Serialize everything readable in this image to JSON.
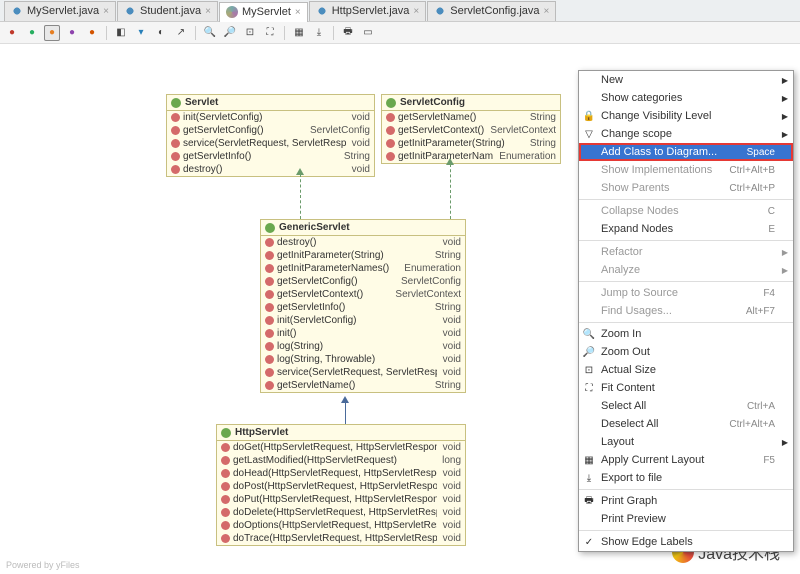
{
  "tabs": [
    {
      "label": "MyServlet.java",
      "icon": "java"
    },
    {
      "label": "Student.java",
      "icon": "java"
    },
    {
      "label": "MyServlet",
      "icon": "diagram",
      "active": true
    },
    {
      "label": "HttpServlet.java",
      "icon": "java"
    },
    {
      "label": "ServletConfig.java",
      "icon": "java"
    }
  ],
  "uml": {
    "servlet": {
      "title": "Servlet",
      "methods": [
        {
          "name": "init(ServletConfig)",
          "ret": "void"
        },
        {
          "name": "getServletConfig()",
          "ret": "ServletConfig"
        },
        {
          "name": "service(ServletRequest, ServletResponse)",
          "ret": "void"
        },
        {
          "name": "getServletInfo()",
          "ret": "String"
        },
        {
          "name": "destroy()",
          "ret": "void"
        }
      ]
    },
    "servletConfig": {
      "title": "ServletConfig",
      "methods": [
        {
          "name": "getServletName()",
          "ret": "String"
        },
        {
          "name": "getServletContext()",
          "ret": "ServletContext"
        },
        {
          "name": "getInitParameter(String)",
          "ret": "String"
        },
        {
          "name": "getInitParameterNames()",
          "ret": "Enumeration"
        }
      ]
    },
    "genericServlet": {
      "title": "GenericServlet",
      "methods": [
        {
          "name": "destroy()",
          "ret": "void"
        },
        {
          "name": "getInitParameter(String)",
          "ret": "String"
        },
        {
          "name": "getInitParameterNames()",
          "ret": "Enumeration"
        },
        {
          "name": "getServletConfig()",
          "ret": "ServletConfig"
        },
        {
          "name": "getServletContext()",
          "ret": "ServletContext"
        },
        {
          "name": "getServletInfo()",
          "ret": "String"
        },
        {
          "name": "init(ServletConfig)",
          "ret": "void"
        },
        {
          "name": "init()",
          "ret": "void"
        },
        {
          "name": "log(String)",
          "ret": "void"
        },
        {
          "name": "log(String, Throwable)",
          "ret": "void"
        },
        {
          "name": "service(ServletRequest, ServletResponse)",
          "ret": "void"
        },
        {
          "name": "getServletName()",
          "ret": "String"
        }
      ]
    },
    "httpServlet": {
      "title": "HttpServlet",
      "methods": [
        {
          "name": "doGet(HttpServletRequest, HttpServletResponse)",
          "ret": "void"
        },
        {
          "name": "getLastModified(HttpServletRequest)",
          "ret": "long"
        },
        {
          "name": "doHead(HttpServletRequest, HttpServletResponse)",
          "ret": "void"
        },
        {
          "name": "doPost(HttpServletRequest, HttpServletResponse)",
          "ret": "void"
        },
        {
          "name": "doPut(HttpServletRequest, HttpServletResponse)",
          "ret": "void"
        },
        {
          "name": "doDelete(HttpServletRequest, HttpServletResponse)",
          "ret": "void"
        },
        {
          "name": "doOptions(HttpServletRequest, HttpServletResponse)",
          "ret": "void"
        },
        {
          "name": "doTrace(HttpServletRequest, HttpServletResponse)",
          "ret": "void"
        }
      ]
    }
  },
  "menu": [
    {
      "label": "New",
      "arrow": true
    },
    {
      "label": "Show categories",
      "arrow": true
    },
    {
      "label": "Change Visibility Level",
      "arrow": true,
      "icon": "vis"
    },
    {
      "label": "Change scope",
      "arrow": true,
      "icon": "scope"
    },
    {
      "label": "Add Class to Diagram...",
      "shortcut": "Space",
      "highlight": true
    },
    {
      "label": "Show Implementations",
      "shortcut": "Ctrl+Alt+B",
      "disabled": true
    },
    {
      "label": "Show Parents",
      "shortcut": "Ctrl+Alt+P",
      "disabled": true
    },
    {
      "sep": true
    },
    {
      "label": "Collapse Nodes",
      "shortcut": "C",
      "disabled": true
    },
    {
      "label": "Expand Nodes",
      "shortcut": "E"
    },
    {
      "sep": true
    },
    {
      "label": "Refactor",
      "arrow": true,
      "disabled": true
    },
    {
      "label": "Analyze",
      "arrow": true,
      "disabled": true
    },
    {
      "sep": true
    },
    {
      "label": "Jump to Source",
      "shortcut": "F4",
      "disabled": true
    },
    {
      "label": "Find Usages...",
      "shortcut": "Alt+F7",
      "disabled": true
    },
    {
      "sep": true
    },
    {
      "label": "Zoom In",
      "icon": "zi"
    },
    {
      "label": "Zoom Out",
      "icon": "zo"
    },
    {
      "label": "Actual Size",
      "icon": "as"
    },
    {
      "label": "Fit Content",
      "icon": "fc"
    },
    {
      "label": "Select All",
      "shortcut": "Ctrl+A"
    },
    {
      "label": "Deselect All",
      "shortcut": "Ctrl+Alt+A"
    },
    {
      "label": "Layout",
      "arrow": true
    },
    {
      "label": "Apply Current Layout",
      "shortcut": "F5",
      "icon": "ly"
    },
    {
      "label": "Export to file",
      "icon": "ex"
    },
    {
      "sep": true
    },
    {
      "label": "Print Graph",
      "icon": "pr"
    },
    {
      "label": "Print Preview"
    },
    {
      "sep": true
    },
    {
      "label": "Show Edge Labels",
      "check": true
    }
  ],
  "footer": "Powered by yFiles",
  "watermark": "Java技术栈"
}
